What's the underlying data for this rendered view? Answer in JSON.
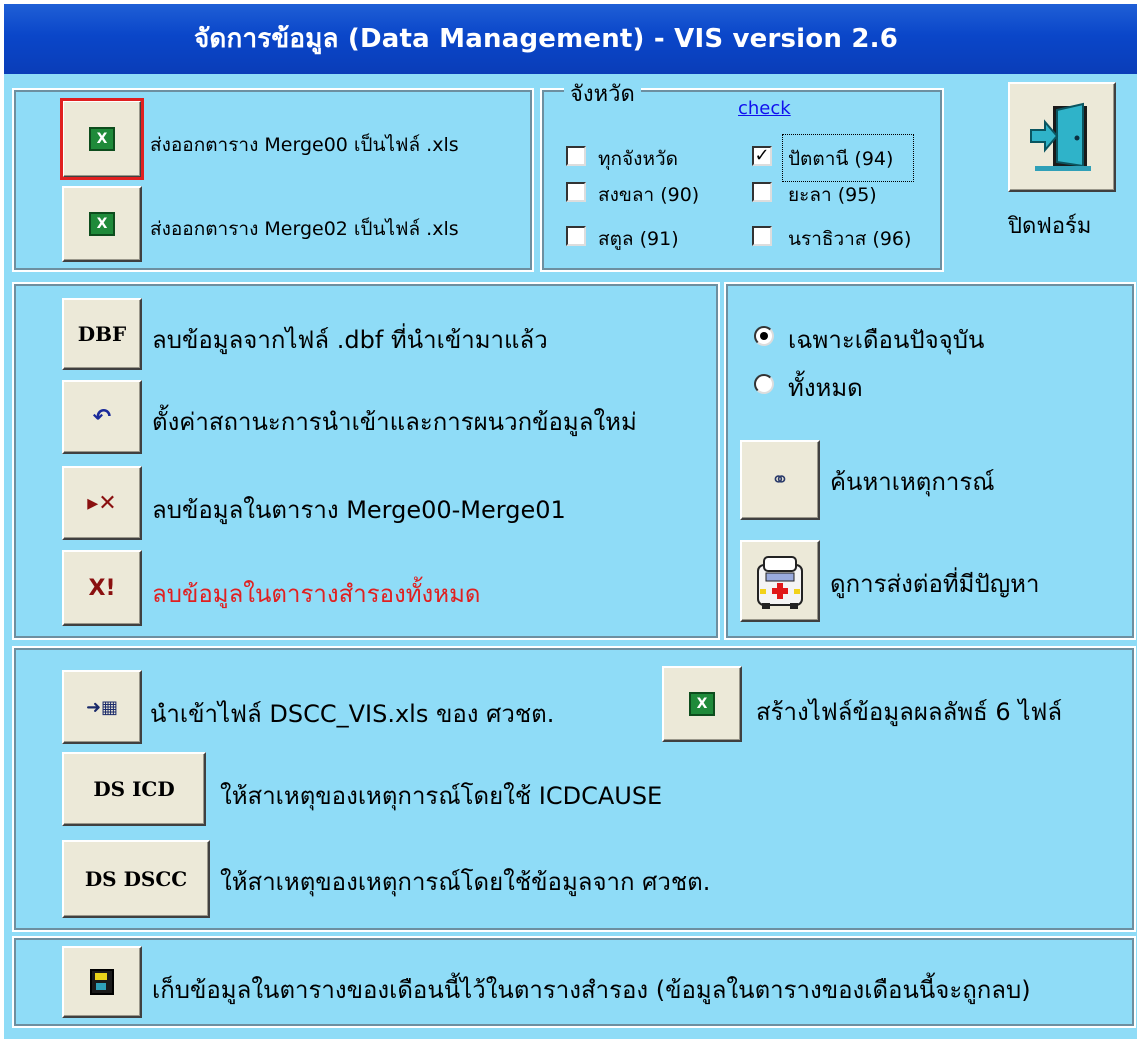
{
  "window": {
    "title": "จัดการข้อมูล  (Data Management) - VIS version 2.6"
  },
  "export": {
    "merge00_label": "ส่งออกตาราง Merge00 เป็นไฟล์ .xls",
    "merge02_label": "ส่งออกตาราง Merge02 เป็นไฟล์ .xls",
    "xls_icon_glyph": "X"
  },
  "province": {
    "legend": "จังหวัด",
    "check_link": "check",
    "items": [
      {
        "label": "ทุกจังหวัด",
        "checked": false
      },
      {
        "label": "ปัตตานี (94)",
        "checked": true
      },
      {
        "label": "สงขลา (90)",
        "checked": false
      },
      {
        "label": "ยะลา (95)",
        "checked": false
      },
      {
        "label": "สตูล (91)",
        "checked": false
      },
      {
        "label": "นราธิวาส (96)",
        "checked": false
      }
    ]
  },
  "close": {
    "label": "ปิดฟอร์ม"
  },
  "actions": {
    "dbf_button": "DBF",
    "dbf_label": "ลบข้อมูลจากไฟล์ .dbf ที่นำเข้ามาแล้ว",
    "reset_label": "ตั้งค่าสถานะการนำเข้าและการผนวกข้อมูลใหม่",
    "delete_merge_label": "ลบข้อมูลในตาราง Merge00-Merge01",
    "delete_backup_label": "ลบข้อมูลในตารางสำรองทั้งหมด",
    "delete_backup_glyph": "X!"
  },
  "search": {
    "current_month": "เฉพาะเดือนปัจจุบัน",
    "all": "ทั้งหมด",
    "find_event": "ค้นหาเหตุการณ์",
    "view_referral": "ดูการส่งต่อที่มีปัญหา"
  },
  "import": {
    "dscc_label": "นำเข้าไฟล์ DSCC_VIS.xls ของ ศวชต.",
    "create_files_label": "สร้างไฟล์ข้อมูลผลลัพธ์ 6 ไฟล์",
    "dsicd_button": "DS ICD",
    "dsicd_label": "ให้สาเหตุของเหตุการณ์โดยใช้ ICDCAUSE",
    "dsdscc_button": "DS DSCC",
    "dsdscc_label": "ให้สาเหตุของเหตุการณ์โดยใช้ข้อมูลจาก ศวชต."
  },
  "archive": {
    "label": "เก็บข้อมูลในตารางของเดือนนี้ไว้ในตารางสำรอง (ข้อมูลในตารางของเดือนนี้จะถูกลบ)"
  }
}
